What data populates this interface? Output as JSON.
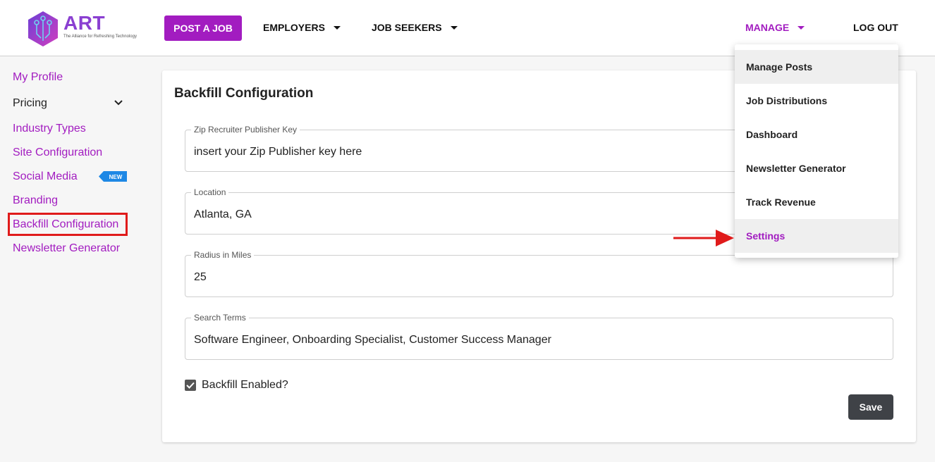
{
  "header": {
    "logo": {
      "name": "ART",
      "tagline": "The Alliance for Refreshing Technology"
    },
    "post_job_label": "POST A JOB",
    "nav": {
      "employers": "EMPLOYERS",
      "job_seekers": "JOB SEEKERS",
      "manage": "MANAGE",
      "logout": "LOG OUT"
    }
  },
  "sidebar": {
    "items": [
      {
        "label": "My Profile"
      },
      {
        "label": "Pricing"
      },
      {
        "label": "Industry Types"
      },
      {
        "label": "Site Configuration"
      },
      {
        "label": "Social Media",
        "badge": "NEW"
      },
      {
        "label": "Branding"
      },
      {
        "label": "Backfill Configuration"
      },
      {
        "label": "Newsletter Generator"
      }
    ]
  },
  "card": {
    "title": "Backfill Configuration",
    "fields": [
      {
        "label": "Zip Recruiter Publisher Key",
        "value": "insert your Zip Publisher key here"
      },
      {
        "label": "Location",
        "value": "Atlanta, GA"
      },
      {
        "label": "Radius in Miles",
        "value": "25"
      },
      {
        "label": "Search Terms",
        "value": "Software Engineer, Onboarding Specialist, Customer Success Manager"
      }
    ],
    "checkbox": {
      "label": "Backfill Enabled?",
      "checked": true
    },
    "save_label": "Save"
  },
  "manage_menu": {
    "items": [
      {
        "label": "Manage Posts"
      },
      {
        "label": "Job Distributions"
      },
      {
        "label": "Dashboard"
      },
      {
        "label": "Newsletter Generator"
      },
      {
        "label": "Track Revenue"
      },
      {
        "label": "Settings"
      }
    ]
  },
  "colors": {
    "accent": "#a21cc0",
    "save_button": "#3f4247",
    "annotation_red": "#e01b1b",
    "badge_blue": "#1e88e5"
  }
}
